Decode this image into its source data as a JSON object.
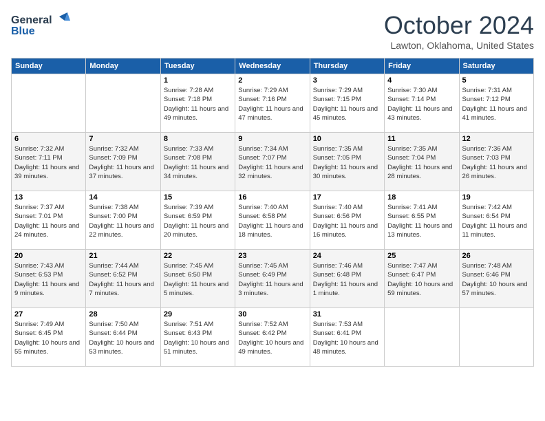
{
  "logo": {
    "line1": "General",
    "line2": "Blue"
  },
  "header": {
    "month": "October 2024",
    "location": "Lawton, Oklahoma, United States"
  },
  "weekdays": [
    "Sunday",
    "Monday",
    "Tuesday",
    "Wednesday",
    "Thursday",
    "Friday",
    "Saturday"
  ],
  "weeks": [
    [
      {
        "day": "",
        "sunrise": "",
        "sunset": "",
        "daylight": ""
      },
      {
        "day": "",
        "sunrise": "",
        "sunset": "",
        "daylight": ""
      },
      {
        "day": "1",
        "sunrise": "Sunrise: 7:28 AM",
        "sunset": "Sunset: 7:18 PM",
        "daylight": "Daylight: 11 hours and 49 minutes."
      },
      {
        "day": "2",
        "sunrise": "Sunrise: 7:29 AM",
        "sunset": "Sunset: 7:16 PM",
        "daylight": "Daylight: 11 hours and 47 minutes."
      },
      {
        "day": "3",
        "sunrise": "Sunrise: 7:29 AM",
        "sunset": "Sunset: 7:15 PM",
        "daylight": "Daylight: 11 hours and 45 minutes."
      },
      {
        "day": "4",
        "sunrise": "Sunrise: 7:30 AM",
        "sunset": "Sunset: 7:14 PM",
        "daylight": "Daylight: 11 hours and 43 minutes."
      },
      {
        "day": "5",
        "sunrise": "Sunrise: 7:31 AM",
        "sunset": "Sunset: 7:12 PM",
        "daylight": "Daylight: 11 hours and 41 minutes."
      }
    ],
    [
      {
        "day": "6",
        "sunrise": "Sunrise: 7:32 AM",
        "sunset": "Sunset: 7:11 PM",
        "daylight": "Daylight: 11 hours and 39 minutes."
      },
      {
        "day": "7",
        "sunrise": "Sunrise: 7:32 AM",
        "sunset": "Sunset: 7:09 PM",
        "daylight": "Daylight: 11 hours and 37 minutes."
      },
      {
        "day": "8",
        "sunrise": "Sunrise: 7:33 AM",
        "sunset": "Sunset: 7:08 PM",
        "daylight": "Daylight: 11 hours and 34 minutes."
      },
      {
        "day": "9",
        "sunrise": "Sunrise: 7:34 AM",
        "sunset": "Sunset: 7:07 PM",
        "daylight": "Daylight: 11 hours and 32 minutes."
      },
      {
        "day": "10",
        "sunrise": "Sunrise: 7:35 AM",
        "sunset": "Sunset: 7:05 PM",
        "daylight": "Daylight: 11 hours and 30 minutes."
      },
      {
        "day": "11",
        "sunrise": "Sunrise: 7:35 AM",
        "sunset": "Sunset: 7:04 PM",
        "daylight": "Daylight: 11 hours and 28 minutes."
      },
      {
        "day": "12",
        "sunrise": "Sunrise: 7:36 AM",
        "sunset": "Sunset: 7:03 PM",
        "daylight": "Daylight: 11 hours and 26 minutes."
      }
    ],
    [
      {
        "day": "13",
        "sunrise": "Sunrise: 7:37 AM",
        "sunset": "Sunset: 7:01 PM",
        "daylight": "Daylight: 11 hours and 24 minutes."
      },
      {
        "day": "14",
        "sunrise": "Sunrise: 7:38 AM",
        "sunset": "Sunset: 7:00 PM",
        "daylight": "Daylight: 11 hours and 22 minutes."
      },
      {
        "day": "15",
        "sunrise": "Sunrise: 7:39 AM",
        "sunset": "Sunset: 6:59 PM",
        "daylight": "Daylight: 11 hours and 20 minutes."
      },
      {
        "day": "16",
        "sunrise": "Sunrise: 7:40 AM",
        "sunset": "Sunset: 6:58 PM",
        "daylight": "Daylight: 11 hours and 18 minutes."
      },
      {
        "day": "17",
        "sunrise": "Sunrise: 7:40 AM",
        "sunset": "Sunset: 6:56 PM",
        "daylight": "Daylight: 11 hours and 16 minutes."
      },
      {
        "day": "18",
        "sunrise": "Sunrise: 7:41 AM",
        "sunset": "Sunset: 6:55 PM",
        "daylight": "Daylight: 11 hours and 13 minutes."
      },
      {
        "day": "19",
        "sunrise": "Sunrise: 7:42 AM",
        "sunset": "Sunset: 6:54 PM",
        "daylight": "Daylight: 11 hours and 11 minutes."
      }
    ],
    [
      {
        "day": "20",
        "sunrise": "Sunrise: 7:43 AM",
        "sunset": "Sunset: 6:53 PM",
        "daylight": "Daylight: 11 hours and 9 minutes."
      },
      {
        "day": "21",
        "sunrise": "Sunrise: 7:44 AM",
        "sunset": "Sunset: 6:52 PM",
        "daylight": "Daylight: 11 hours and 7 minutes."
      },
      {
        "day": "22",
        "sunrise": "Sunrise: 7:45 AM",
        "sunset": "Sunset: 6:50 PM",
        "daylight": "Daylight: 11 hours and 5 minutes."
      },
      {
        "day": "23",
        "sunrise": "Sunrise: 7:45 AM",
        "sunset": "Sunset: 6:49 PM",
        "daylight": "Daylight: 11 hours and 3 minutes."
      },
      {
        "day": "24",
        "sunrise": "Sunrise: 7:46 AM",
        "sunset": "Sunset: 6:48 PM",
        "daylight": "Daylight: 11 hours and 1 minute."
      },
      {
        "day": "25",
        "sunrise": "Sunrise: 7:47 AM",
        "sunset": "Sunset: 6:47 PM",
        "daylight": "Daylight: 10 hours and 59 minutes."
      },
      {
        "day": "26",
        "sunrise": "Sunrise: 7:48 AM",
        "sunset": "Sunset: 6:46 PM",
        "daylight": "Daylight: 10 hours and 57 minutes."
      }
    ],
    [
      {
        "day": "27",
        "sunrise": "Sunrise: 7:49 AM",
        "sunset": "Sunset: 6:45 PM",
        "daylight": "Daylight: 10 hours and 55 minutes."
      },
      {
        "day": "28",
        "sunrise": "Sunrise: 7:50 AM",
        "sunset": "Sunset: 6:44 PM",
        "daylight": "Daylight: 10 hours and 53 minutes."
      },
      {
        "day": "29",
        "sunrise": "Sunrise: 7:51 AM",
        "sunset": "Sunset: 6:43 PM",
        "daylight": "Daylight: 10 hours and 51 minutes."
      },
      {
        "day": "30",
        "sunrise": "Sunrise: 7:52 AM",
        "sunset": "Sunset: 6:42 PM",
        "daylight": "Daylight: 10 hours and 49 minutes."
      },
      {
        "day": "31",
        "sunrise": "Sunrise: 7:53 AM",
        "sunset": "Sunset: 6:41 PM",
        "daylight": "Daylight: 10 hours and 48 minutes."
      },
      {
        "day": "",
        "sunrise": "",
        "sunset": "",
        "daylight": ""
      },
      {
        "day": "",
        "sunrise": "",
        "sunset": "",
        "daylight": ""
      }
    ]
  ]
}
